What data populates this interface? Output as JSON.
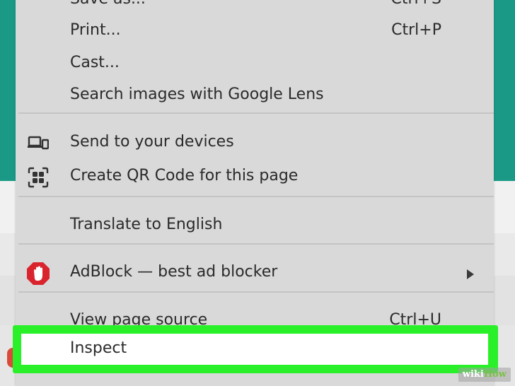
{
  "menu": {
    "items": [
      {
        "label": "Save as...",
        "shortcut": "Ctrl+S"
      },
      {
        "label": "Print...",
        "shortcut": "Ctrl+P"
      },
      {
        "label": "Cast..."
      },
      {
        "label": "Search images with Google Lens"
      },
      {
        "label": "Send to your devices",
        "icon": "devices-icon"
      },
      {
        "label": "Create QR Code for this page",
        "icon": "qr-code-icon"
      },
      {
        "label": "Translate to English"
      },
      {
        "label": "AdBlock — best ad blocker",
        "icon": "adblock-hand-icon",
        "submenu": true
      },
      {
        "label": "View page source",
        "shortcut": "Ctrl+U"
      },
      {
        "label": "Inspect",
        "highlighted": true
      }
    ]
  },
  "colors": {
    "highlight": "#2af02a",
    "adblock_red": "#d9232d",
    "page_teal": "#1a9a86"
  },
  "watermark": {
    "prefix": "wiki",
    "suffix": "How"
  }
}
